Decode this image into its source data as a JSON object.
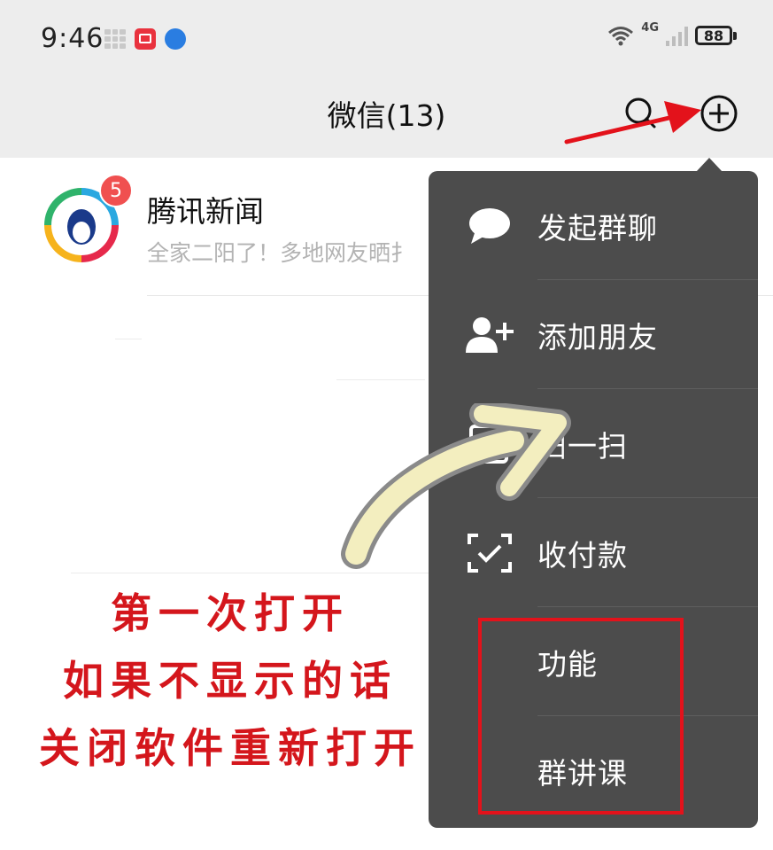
{
  "status_bar": {
    "time": "9:46",
    "network": "4G",
    "battery": "88"
  },
  "header": {
    "title": "微信(13)"
  },
  "chats": [
    {
      "name": "腾讯新闻",
      "preview": "全家二阳了！多地网友晒扌",
      "unread": "5"
    }
  ],
  "menu": {
    "items": [
      {
        "label": "发起群聊",
        "icon": "chat-bubble-icon"
      },
      {
        "label": "添加朋友",
        "icon": "add-friend-icon"
      },
      {
        "label": "扫一扫",
        "icon": "scan-icon"
      },
      {
        "label": "收付款",
        "icon": "payment-icon"
      },
      {
        "label": "功能",
        "icon": ""
      },
      {
        "label": "群讲课",
        "icon": ""
      }
    ]
  },
  "annotation": {
    "lines": [
      "第一次打开",
      "如果不显示的话",
      "关闭软件重新打开"
    ]
  },
  "colors": {
    "header_bg": "#ededed",
    "menu_bg": "#4c4c4c",
    "badge": "#f05050",
    "annotation_red": "#d4161c"
  }
}
